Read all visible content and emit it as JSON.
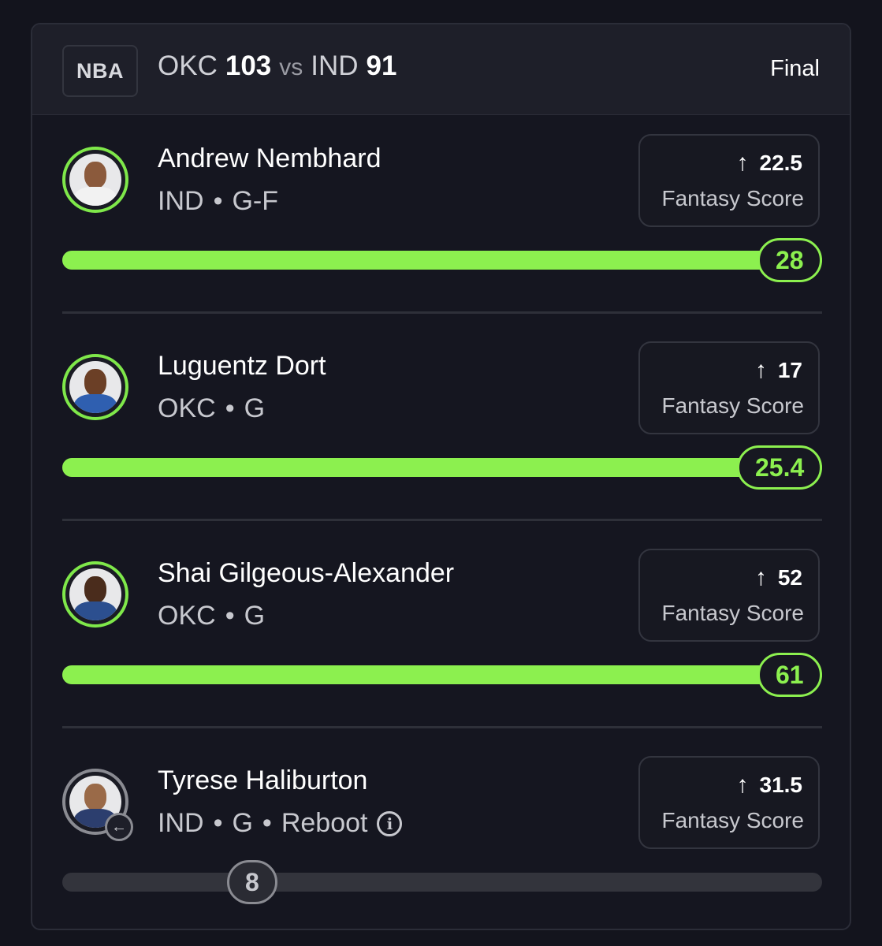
{
  "game": {
    "league": "NBA",
    "home_team": "OKC",
    "home_score": "103",
    "vs": "vs",
    "away_team": "IND",
    "away_score": "91",
    "status": "Final"
  },
  "colors": {
    "accent_green": "#8cf04f",
    "inactive_gray": "#8a8b92",
    "background": "#13141d"
  },
  "players": [
    {
      "name": "Andrew Nembhard",
      "team": "IND",
      "position": "G-F",
      "line": "22.5",
      "stat_label": "Fantasy Score",
      "direction_icon": "arrow-up-icon",
      "actual": "28",
      "progress_fraction": 1.0,
      "active": true
    },
    {
      "name": "Luguentz Dort",
      "team": "OKC",
      "position": "G",
      "line": "17",
      "stat_label": "Fantasy Score",
      "direction_icon": "arrow-up-icon",
      "actual": "25.4",
      "progress_fraction": 1.0,
      "active": true
    },
    {
      "name": "Shai Gilgeous-Alexander",
      "team": "OKC",
      "position": "G",
      "line": "52",
      "stat_label": "Fantasy Score",
      "direction_icon": "arrow-up-icon",
      "actual": "61",
      "progress_fraction": 1.0,
      "active": true
    },
    {
      "name": "Tyrese Haliburton",
      "team": "IND",
      "position": "G",
      "tag": "Reboot",
      "line": "31.5",
      "stat_label": "Fantasy Score",
      "direction_icon": "arrow-up-icon",
      "actual": "8",
      "progress_fraction": 0.25,
      "active": false
    }
  ]
}
